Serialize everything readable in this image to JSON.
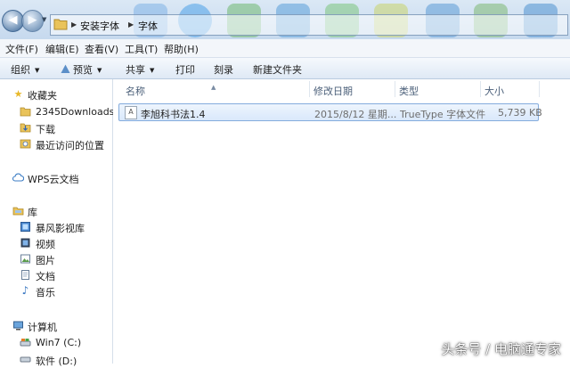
{
  "address": {
    "crumbs": [
      "安装字体",
      "字体"
    ]
  },
  "menu": [
    "文件(F)",
    "编辑(E)",
    "查看(V)",
    "工具(T)",
    "帮助(H)"
  ],
  "toolbar": {
    "organize": "组织",
    "preview": "预览",
    "share": "共享",
    "print": "打印",
    "burn": "刻录",
    "new_folder": "新建文件夹"
  },
  "nav": {
    "favorites": "收藏夹",
    "downloads_2345": "2345Downloads",
    "download": "下载",
    "recent": "最近访问的位置",
    "wps": "WPS云文档",
    "library": "库",
    "baofeng": "暴风影视库",
    "video": "视频",
    "pictures": "图片",
    "documents": "文档",
    "music": "音乐",
    "computer": "计算机",
    "drive_c": "Win7 (C:)",
    "drive_d": "软件 (D:)"
  },
  "columns": {
    "name": "名称",
    "modified": "修改日期",
    "type": "类型",
    "size": "大小"
  },
  "files": [
    {
      "name": "李旭科书法1.4",
      "modified": "2015/8/12 星期...",
      "type": "TrueType 字体文件",
      "size": "5,739 KB"
    }
  ],
  "watermark": "头条号 / 电脑通专家",
  "colors": {
    "selection": "#d9e8fb",
    "selection_border": "#84acdd",
    "toolbar": "#dfe9f5"
  }
}
